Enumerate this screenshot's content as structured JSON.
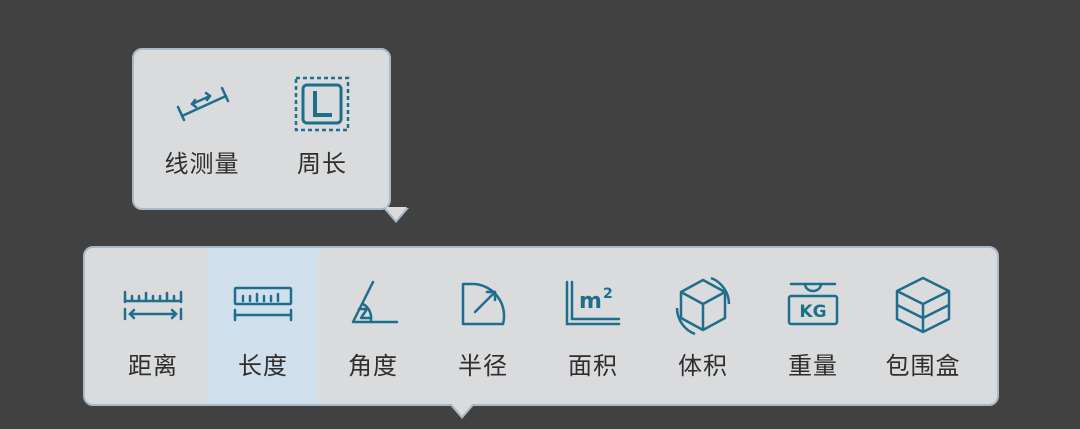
{
  "colors": {
    "background": "#414141",
    "panel": "#d9dbdd",
    "panel_border": "#a9b9c7",
    "icon": "#1e6e8c",
    "selected": "#cfe0ec"
  },
  "sub_popover": {
    "items": [
      {
        "label": "线测量",
        "icon": "line-measure-icon"
      },
      {
        "label": "周长",
        "icon": "perimeter-icon"
      }
    ]
  },
  "main_toolbar": {
    "selected_index": 1,
    "items": [
      {
        "label": "距离",
        "icon": "distance-icon"
      },
      {
        "label": "长度",
        "icon": "length-icon"
      },
      {
        "label": "角度",
        "icon": "angle-icon"
      },
      {
        "label": "半径",
        "icon": "radius-icon"
      },
      {
        "label": "面积",
        "icon": "area-icon"
      },
      {
        "label": "体积",
        "icon": "volume-icon"
      },
      {
        "label": "重量",
        "icon": "weight-icon"
      },
      {
        "label": "包围盒",
        "icon": "bounding-box-icon"
      }
    ]
  }
}
